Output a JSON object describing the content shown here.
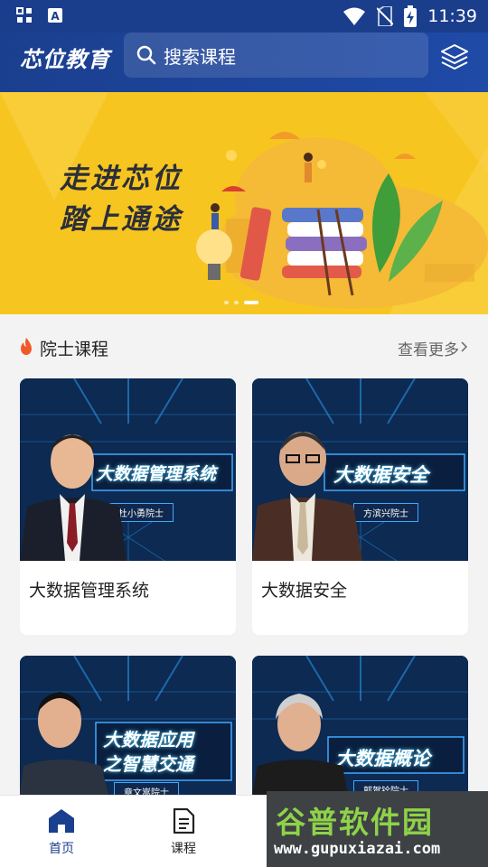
{
  "status_bar": {
    "time": "11:39",
    "icons": [
      "grid-icon",
      "a-badge-icon",
      "wifi-icon",
      "no-sim-icon",
      "battery-charging-icon"
    ]
  },
  "header": {
    "logo": "芯位教育",
    "search_placeholder": "搜索课程",
    "layers_icon": "layers-icon"
  },
  "banner": {
    "slogan_line1": "走进芯位",
    "slogan_line2": "踏上通途",
    "slide_count": 3,
    "active_slide": 3
  },
  "section": {
    "title": "院士课程",
    "more_label": "查看更多"
  },
  "courses": [
    {
      "title": "大数据管理系统",
      "thumb_label": "大数据管理系统",
      "teacher": "杜小勇院士"
    },
    {
      "title": "大数据安全",
      "thumb_label": "大数据安全",
      "teacher": "方滨兴院士"
    },
    {
      "title": "",
      "thumb_label_line1": "大数据应用",
      "thumb_label_line2": "之智慧交通",
      "teacher": "章文嵩院士"
    },
    {
      "title": "",
      "thumb_label": "大数据概论",
      "teacher": "郭贺铨院士"
    }
  ],
  "bottom_nav": [
    {
      "label": "首页",
      "icon": "home-icon",
      "active": true
    },
    {
      "label": "课程",
      "icon": "document-icon",
      "active": false
    }
  ],
  "watermark": {
    "line1": "谷普软件园",
    "line2": "www.gupuxiazai.com"
  },
  "colors": {
    "primary": "#1b3f8f",
    "banner": "#f7c520",
    "accent_fire": "#f05a28"
  }
}
